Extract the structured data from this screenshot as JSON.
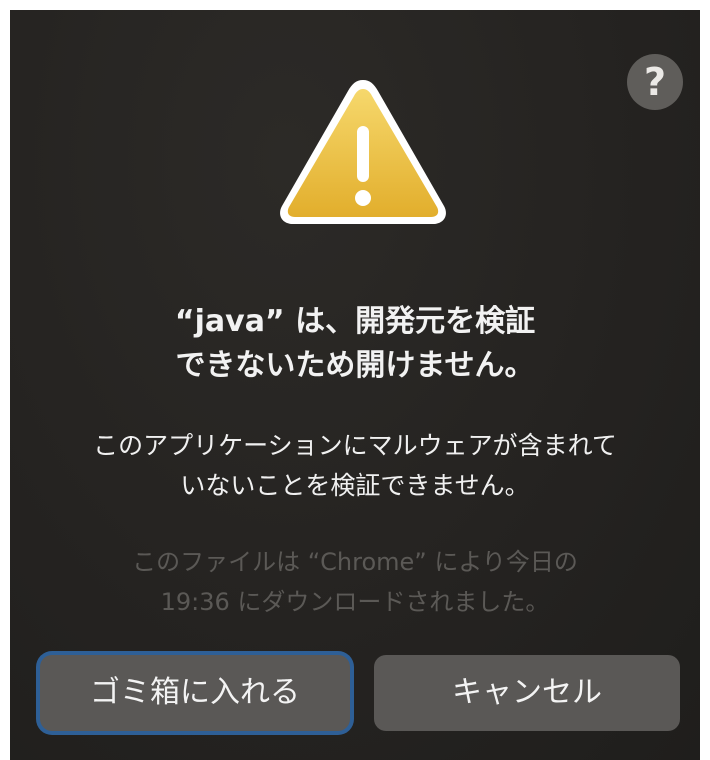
{
  "dialog": {
    "help_label": "?",
    "icon": "warning-triangle-icon",
    "title_line1": "“java” は、開発元を検証",
    "title_line2": "できないため開けません。",
    "message_line1": "このアプリケーションにマルウェアが含まれて",
    "message_line2": "いないことを検証できません。",
    "info_line1": "このファイルは “Chrome” により今日の",
    "info_line2": "19:36 にダウンロードされました。",
    "buttons": {
      "trash_label": "ゴミ箱に入れる",
      "cancel_label": "キャンセル"
    }
  },
  "colors": {
    "background": "#252321",
    "warning_yellow": "#e8b83a",
    "button": "#5a5856",
    "focus_ring": "#2e5f96",
    "help_circle": "#5f5d5a"
  }
}
